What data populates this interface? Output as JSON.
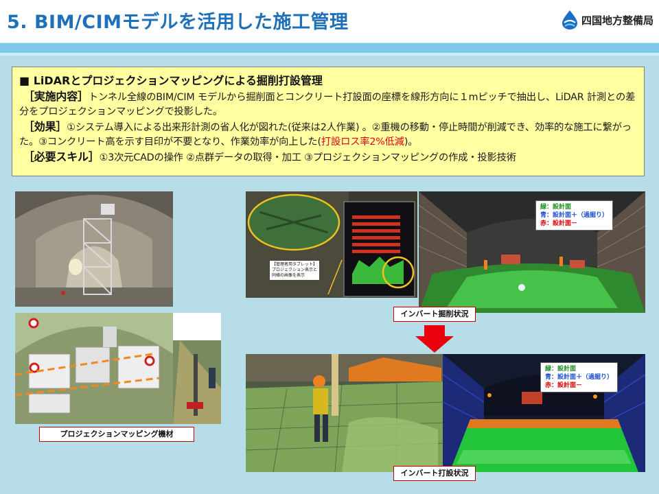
{
  "header": {
    "title": "5. BIM/CIMモデルを活用した施工管理",
    "org_name": "四国地方整備局"
  },
  "info": {
    "heading": "■  LiDARとプロジェクションマッピングによる掘削打設管理",
    "impl_label": "［実施内容］",
    "impl_text": "トンネル全線のBIM/CIM モデルから掘削面とコンクリート打設面の座標を線形方向に１mピッチで抽出し、LiDAR 計測との差分をプロジェクションマッピングで投影した。",
    "effect_label": "［効果］",
    "effect_text": "①システム導入による出来形計測の省人化が図れた(従来は2人作業) 。②重機の移動・停止時間が削減でき、効率的な施工に繋がった。③コンクリート高を示す目印が不要となり、作業効率が向上した(",
    "effect_highlight": "打設ロス率2%低減",
    "effect_tail": ")。",
    "skill_label": "［必要スキル］",
    "skill_text": "①3次元CADの操作 ②点群データの取得・加工 ③プロジェクションマッピングの作成・投影技術"
  },
  "captions": {
    "equipment": "プロジェクションマッピング機材",
    "excavation": "インバート掘削状況",
    "casting": "インバート打設状況"
  },
  "legend": {
    "green": "緑：設計面",
    "blue": "青：設計面＋（過掘り）",
    "red": "赤：設計面－"
  },
  "tablet_note": {
    "line1": "【管理者用タブレット】",
    "line2": "プロジェクション表示と",
    "line3": "同様の画像を表示"
  },
  "colors": {
    "title": "#1e70b8",
    "band": "#7ec9ec",
    "content_bg": "#b7dde8",
    "info_bg": "#ffffa1",
    "highlight": "#e60012",
    "arrow": "#e8000b"
  }
}
